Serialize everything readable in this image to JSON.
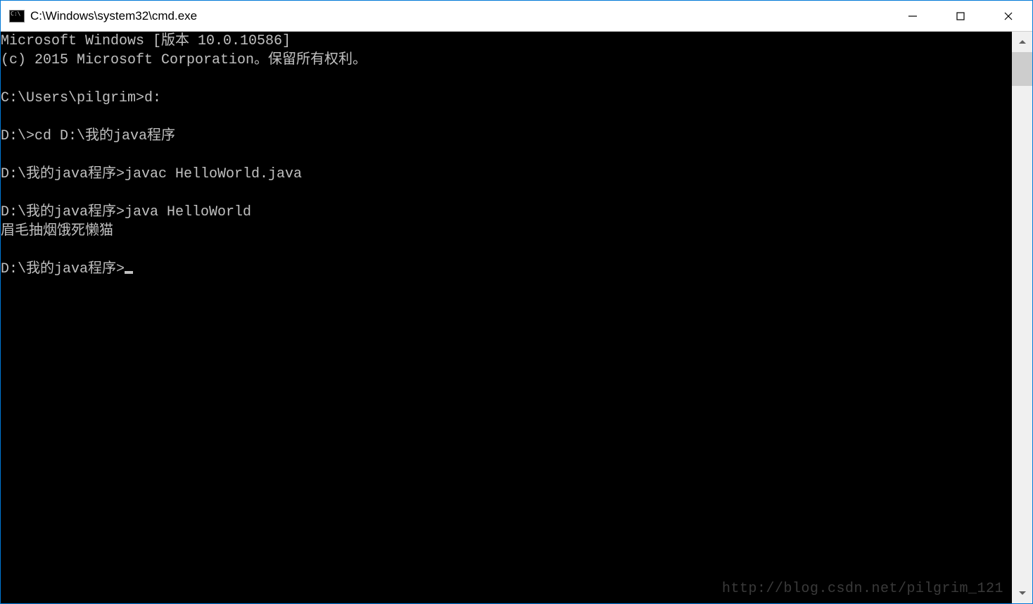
{
  "titlebar": {
    "title": "C:\\Windows\\system32\\cmd.exe"
  },
  "terminal": {
    "lines": [
      "Microsoft Windows [版本 10.0.10586]",
      "(c) 2015 Microsoft Corporation。保留所有权利。",
      "",
      "C:\\Users\\pilgrim>d:",
      "",
      "D:\\>cd D:\\我的java程序",
      "",
      "D:\\我的java程序>javac HelloWorld.java",
      "",
      "D:\\我的java程序>java HelloWorld",
      "眉毛抽烟饿死懒猫",
      "",
      "D:\\我的java程序>"
    ]
  },
  "watermark": "http://blog.csdn.net/pilgrim_121"
}
